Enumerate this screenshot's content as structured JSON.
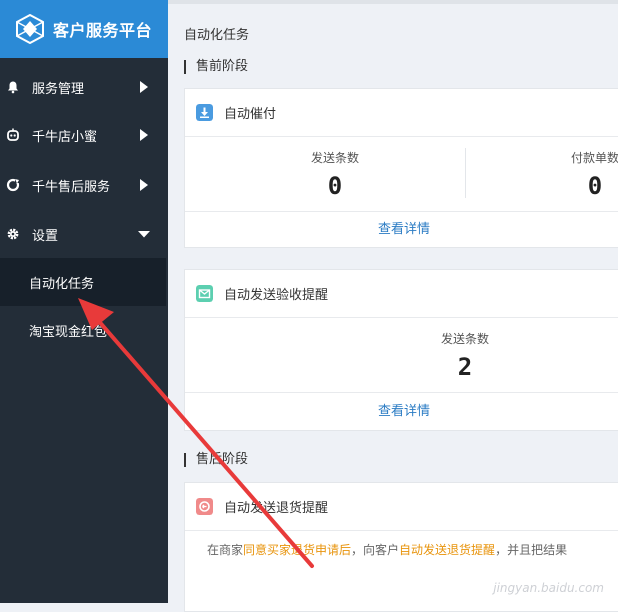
{
  "sidebar": {
    "brand": "客户服务平台",
    "items": [
      {
        "label": "服务管理",
        "icon": "bell-icon",
        "arrow": "right"
      },
      {
        "label": "千牛店小蜜",
        "icon": "robot-icon",
        "arrow": "right"
      },
      {
        "label": "千牛售后服务",
        "icon": "refresh-icon",
        "arrow": "right"
      },
      {
        "label": "设置",
        "icon": "gear-icon",
        "arrow": "down"
      }
    ],
    "sub_items": [
      {
        "label": "自动化任务",
        "active": true
      },
      {
        "label": "淘宝现金红包",
        "active": false
      }
    ]
  },
  "main": {
    "title": "自动化任务",
    "sections": [
      {
        "title": "售前阶段"
      },
      {
        "title": "售后阶段"
      }
    ],
    "cards": [
      {
        "title": "自动催付",
        "icon": "download-icon",
        "stats": [
          {
            "label": "发送条数",
            "value": "0"
          },
          {
            "label": "付款单数",
            "value": "0"
          }
        ],
        "link": "查看详情"
      },
      {
        "title": "自动发送验收提醒",
        "icon": "mail-icon",
        "stats": [
          {
            "label": "发送条数",
            "value": "2"
          }
        ],
        "link": "查看详情"
      },
      {
        "title": "自动发送退货提醒",
        "icon": "return-icon",
        "desc": {
          "p1": "在商家",
          "h1": "同意买家退货申请后",
          "p2": "，向客户",
          "h2": "自动发送退货提醒",
          "p3": "，并且把结果"
        }
      }
    ]
  },
  "watermark": "jingyan.baidu.com",
  "colors": {
    "sidebar": "#232d38",
    "brand": "#2b8ad6",
    "link": "#2b7cc4",
    "highlight": "#e8940d",
    "annotation_arrow": "#e83a3a"
  }
}
